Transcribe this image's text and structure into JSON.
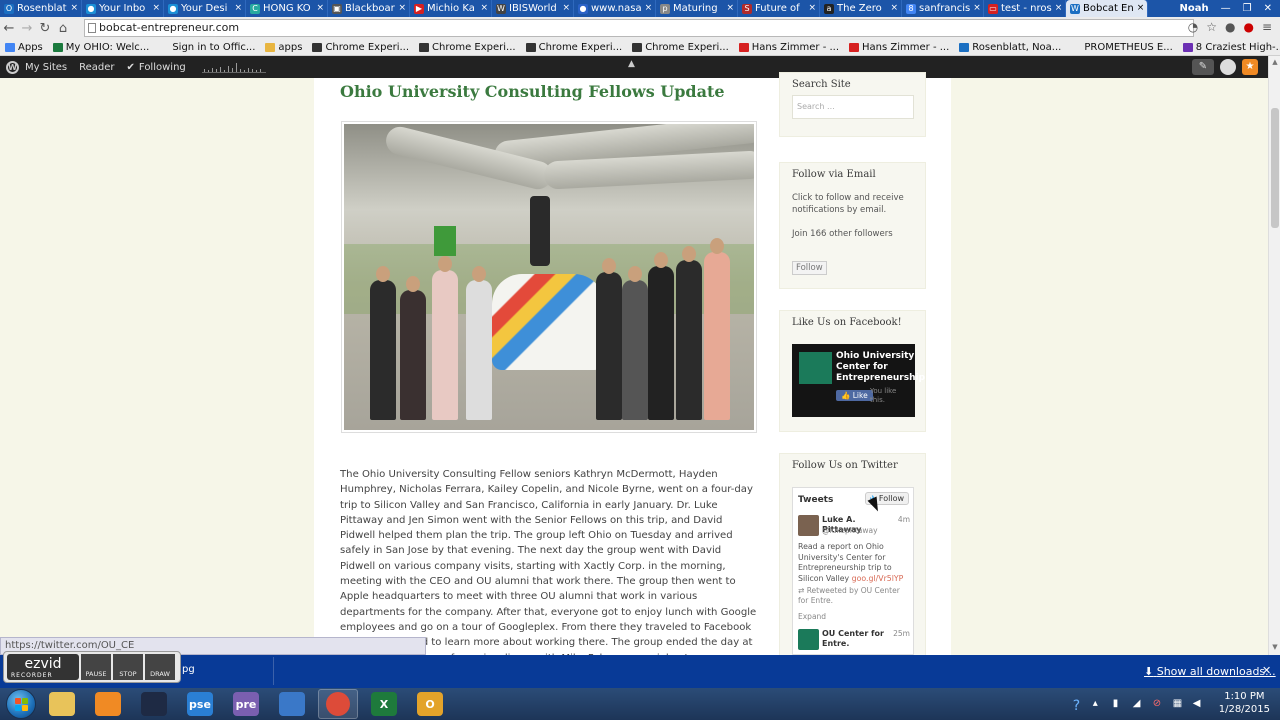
{
  "browser": {
    "tabs": [
      {
        "label": "Rosenblat",
        "favicon": "O",
        "color": "#1b6fc2"
      },
      {
        "label": "Your Inbo",
        "favicon": "●",
        "color": "#1b8fd6"
      },
      {
        "label": "Your Desi",
        "favicon": "●",
        "color": "#1b8fd6"
      },
      {
        "label": "HONG KO",
        "favicon": "C",
        "color": "#27a9a0"
      },
      {
        "label": "Blackboar",
        "favicon": "▣",
        "color": "#555555"
      },
      {
        "label": "Michio Ka",
        "favicon": "▶",
        "color": "#d62020"
      },
      {
        "label": "IBISWorld",
        "favicon": "W",
        "color": "#444444"
      },
      {
        "label": "www.nasa",
        "favicon": "●",
        "color": "#2a62c7"
      },
      {
        "label": "Maturing",
        "favicon": "p",
        "color": "#888888"
      },
      {
        "label": "Future of",
        "favicon": "S",
        "color": "#b12a2a"
      },
      {
        "label": "The Zero",
        "favicon": "a",
        "color": "#222222"
      },
      {
        "label": "sanfrancis",
        "favicon": "8",
        "color": "#4285f4"
      },
      {
        "label": "test - nros",
        "favicon": "▭",
        "color": "#d62020"
      },
      {
        "label": "Bobcat En",
        "favicon": "W",
        "color": "#1b6fc2"
      }
    ],
    "active_tab_index": 13,
    "user": "Noah",
    "address": "bobcat-entrepreneur.com",
    "bookmarks": [
      {
        "label": "Apps",
        "icon": "apps-grid-icon",
        "color": "#4285f4"
      },
      {
        "label": "My OHIO: Welc...",
        "icon": "ohio-icon",
        "color": "#1b7a3e"
      },
      {
        "label": "Sign in to Offic...",
        "icon": "page-icon",
        "color": "#ececec"
      },
      {
        "label": "apps",
        "icon": "folder-icon",
        "color": "#e8b540"
      },
      {
        "label": "Chrome Experi...",
        "icon": "chrome-experiments-icon",
        "color": "#333333"
      },
      {
        "label": "Chrome Experi...",
        "icon": "chrome-experiments-icon",
        "color": "#333333"
      },
      {
        "label": "Chrome Experi...",
        "icon": "chrome-experiments-icon",
        "color": "#333333"
      },
      {
        "label": "Chrome Experi...",
        "icon": "chrome-experiments-icon",
        "color": "#333333"
      },
      {
        "label": "Hans Zimmer - ...",
        "icon": "youtube-icon",
        "color": "#d62020"
      },
      {
        "label": "Hans Zimmer - ...",
        "icon": "youtube-icon",
        "color": "#d62020"
      },
      {
        "label": "Rosenblatt, Noa...",
        "icon": "outlook-icon",
        "color": "#1b6fc2"
      },
      {
        "label": "PROMETHEUS E...",
        "icon": "page-icon",
        "color": "#ececec"
      },
      {
        "label": "8 Craziest High-...",
        "icon": "yahoo-icon",
        "color": "#6b2fb3"
      }
    ]
  },
  "wpbar": {
    "my_sites": "My Sites",
    "reader": "Reader",
    "following": "Following"
  },
  "post": {
    "title": "Ohio University Consulting Fellows Update",
    "body": "The Ohio University Consulting Fellow seniors Kathryn McDermott, Hayden Humphrey, Nicholas Ferrara, Kailey Copelin, and Nicole Byrne, went on a four-day trip to Silicon Valley and San Francisco, California in early January. Dr. Luke Pittaway and Jen Simon went with the Senior Fellows on this trip, and David Pidwell helped them plan the trip. The group left Ohio on Tuesday and arrived safely in San Jose by that evening. The next day the group went with David Pidwell on various company visits, starting with Xactly Corp. in the morning, meeting with the CEO and OU alumni that work there. The group then went to Apple headquarters to meet with three OU alumni that work in various departments for the company. After that, everyone got to enjoy lunch with Google employees and go on a tour of Googleplex. From there they traveled to Facebook HQ for a tour and to learn more about working there. The group ended the day at David Pidwell's home for a nice dinner with Mike Folgner, a serial entrepreneur, as well as Dean Hugh Sherman and Jess Steel."
  },
  "sidebar": {
    "search": {
      "title": "Search Site",
      "placeholder": "Search ..."
    },
    "email": {
      "title": "Follow via Email",
      "desc": "Click to follow and receive notifications by email.",
      "count": "Join 166 other followers",
      "button": "Follow"
    },
    "facebook": {
      "title": "Like Us on Facebook!",
      "page_name": "Ohio University Center for Entrepreneurship",
      "like": "Like",
      "like_text": "You like this."
    },
    "twitter": {
      "title": "Follow Us on Twitter",
      "header": "Tweets",
      "follow": "Follow",
      "tweet1": {
        "name": "Luke A. Pittaway",
        "handle": "@lukepittaway",
        "time": "4m",
        "text": "Read a report on Ohio University's Center for Entrepreneurship trip to Silicon Valley",
        "link": "goo.gl/Vr5lYP",
        "retweet": "Retweeted by OU Center for Entre.",
        "expand": "Expand"
      },
      "tweet2": {
        "name": "OU Center for Entre.",
        "time": "25m"
      }
    }
  },
  "status_link": "https://twitter.com/OU_CE",
  "recorder": {
    "logo": "ezvid",
    "sub": "RECORDER",
    "pause": "PAUSE",
    "stop": "STOP",
    "draw": "DRAW"
  },
  "downloads": {
    "item": "pg",
    "show_all": "Show all downloads..."
  },
  "taskbar": {
    "apps": [
      {
        "name": "explorer",
        "label": "",
        "color": "#e8c35a"
      },
      {
        "name": "media-player",
        "label": "",
        "color": "#f08a24"
      },
      {
        "name": "ezvid",
        "label": "",
        "color": "#1e2a44"
      },
      {
        "name": "photoshop-elements",
        "label": "pse",
        "color": "#2a7fd4"
      },
      {
        "name": "premiere",
        "label": "pre",
        "color": "#7a5fb0"
      },
      {
        "name": "metro-apps",
        "label": "",
        "color": "#3a78c8"
      },
      {
        "name": "chrome",
        "label": "",
        "color": "#dd4b39"
      },
      {
        "name": "excel",
        "label": "X",
        "color": "#1e7a3c"
      },
      {
        "name": "outlook",
        "label": "O",
        "color": "#e3a32a"
      }
    ],
    "time": "1:10 PM",
    "date": "1/28/2015"
  }
}
